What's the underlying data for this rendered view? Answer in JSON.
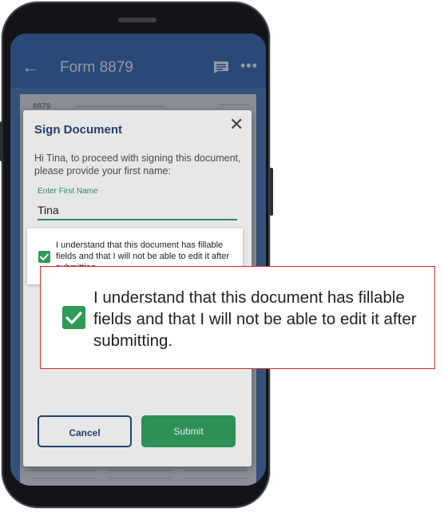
{
  "appbar": {
    "title": "Form 8879"
  },
  "document": {
    "form_number": "8879"
  },
  "dialog": {
    "title": "Sign Document",
    "prompt": "Hi Tina, to proceed with signing this document, please provide your first name:",
    "field_label": "Enter First Name",
    "field_value": "Tina",
    "cancel_label": "Cancel",
    "submit_label": "Submit"
  },
  "consent": {
    "checked": true,
    "text": "I understand that this document has fillable fields and that I will not be able to edit it after submitting."
  },
  "colors": {
    "appbar": "#2e5a9d",
    "accent_green": "#2e9a55",
    "navy": "#22416f",
    "callout_border": "#c9302c"
  }
}
